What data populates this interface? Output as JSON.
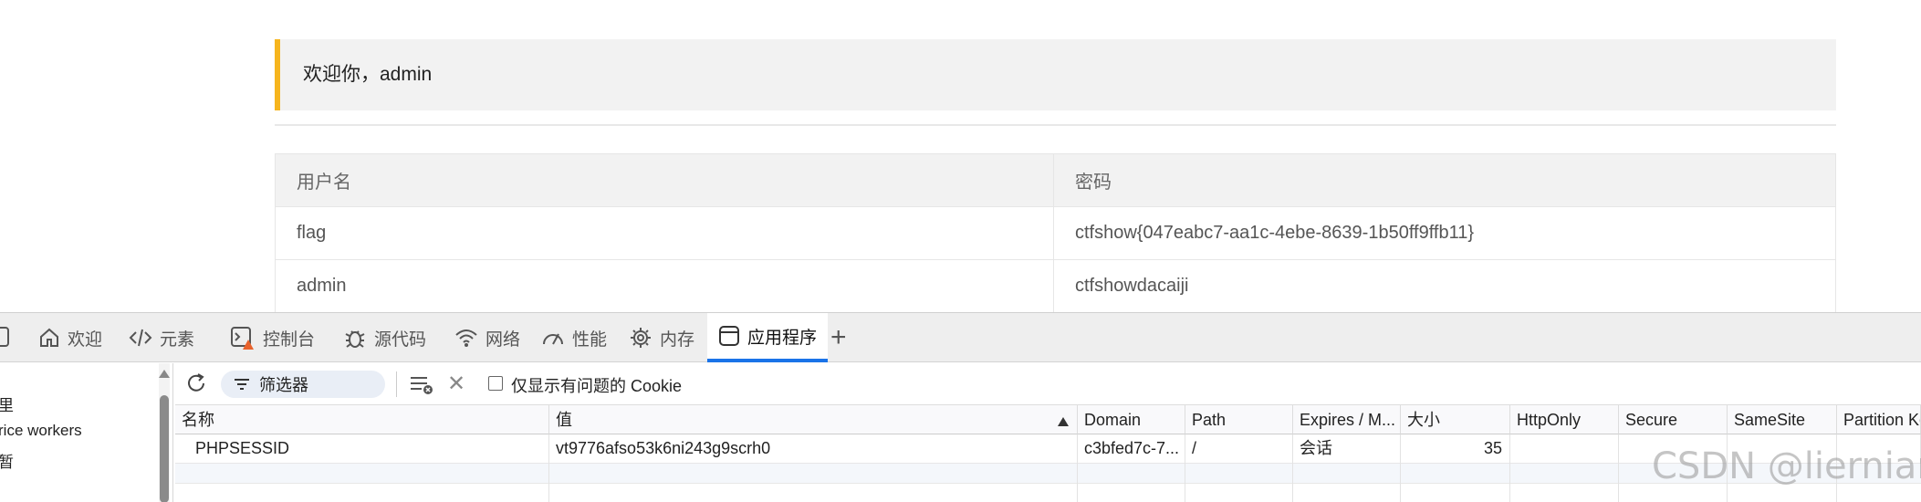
{
  "page": {
    "welcome": "欢迎你，admin",
    "table": {
      "headers": [
        "用户名",
        "密码"
      ],
      "rows": [
        [
          "flag",
          "ctfshow{047eabc7-aa1c-4ebe-8639-1b50ff9ffb11}"
        ],
        [
          "admin",
          "ctfshowdacaiji"
        ]
      ]
    },
    "accent_color": "#f6b51e"
  },
  "devtools": {
    "tabs": [
      {
        "label": "欢迎",
        "icon": "home-icon"
      },
      {
        "label": "元素",
        "icon": "code-icon"
      },
      {
        "label": "控制台",
        "icon": "console-icon"
      },
      {
        "label": "源代码",
        "icon": "bug-icon"
      },
      {
        "label": "网络",
        "icon": "wifi-icon"
      },
      {
        "label": "性能",
        "icon": "gauge-icon"
      },
      {
        "label": "内存",
        "icon": "chip-icon"
      },
      {
        "label": "应用程序",
        "icon": "window-icon",
        "active": true
      }
    ],
    "sidebar": {
      "items": [
        "里",
        "rice workers",
        "暂"
      ]
    },
    "toolbar": {
      "filter_placeholder": "筛选器",
      "only_issues_label": "仅显示有问题的 Cookie"
    },
    "cookies": {
      "columns": [
        "名称",
        "值",
        "Domain",
        "Path",
        "Expires / M...",
        "大小",
        "HttpOnly",
        "Secure",
        "SameSite",
        "Partition Ke"
      ],
      "rows": [
        {
          "name": "PHPSESSID",
          "value": "vt9776afso53k6ni243g9scrh0",
          "domain": "c3bfed7c-7...",
          "path": "/",
          "expires": "会话",
          "size": "35",
          "httponly": "",
          "secure": "",
          "samesite": "",
          "partition": ""
        }
      ]
    },
    "active_tab_color": "#1a73e8"
  },
  "watermark": "CSDN @liernian"
}
